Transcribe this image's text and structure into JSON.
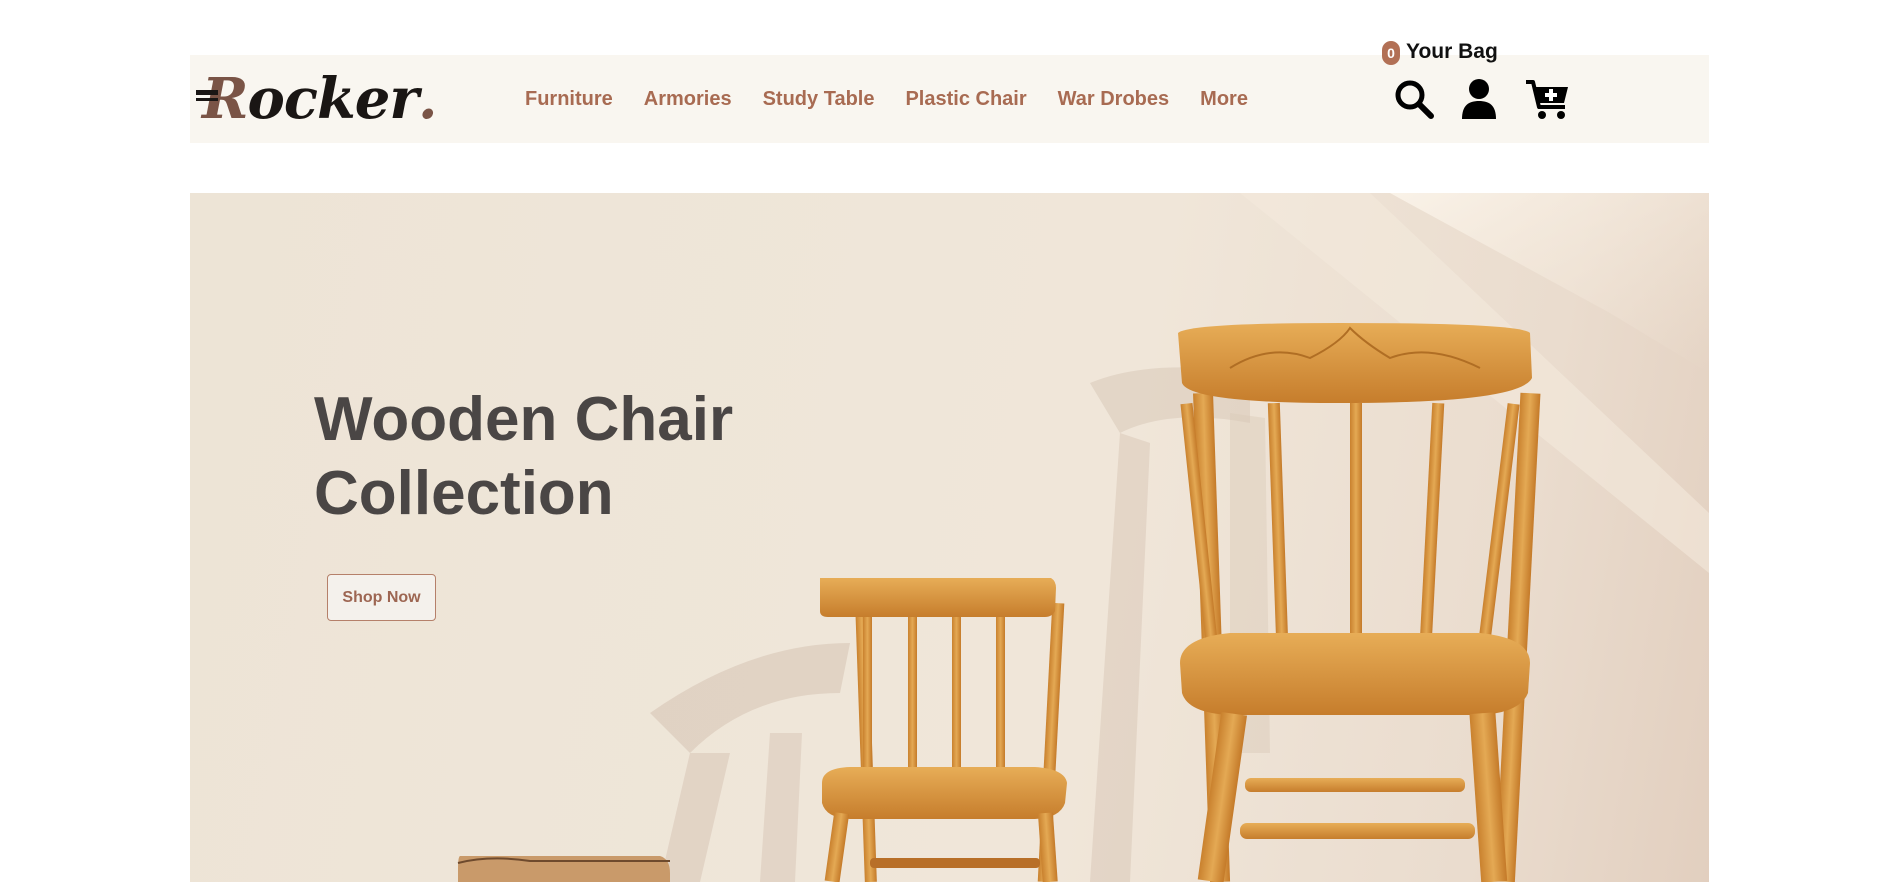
{
  "logo": {
    "text_lead": "R",
    "text_rest": "ocker",
    "text_dot": "."
  },
  "nav": {
    "items": [
      {
        "label": "Furniture"
      },
      {
        "label": "Armories"
      },
      {
        "label": "Study Table"
      },
      {
        "label": "Plastic Chair"
      },
      {
        "label": "War Drobes"
      },
      {
        "label": "More"
      }
    ]
  },
  "header_icons": {
    "search": "search-icon",
    "user": "user-icon",
    "cart": "cart-plus-icon",
    "cart_count": "0",
    "bag_label": "Your Bag"
  },
  "hero": {
    "title_line1": "Wooden Chair",
    "title_line2": "Collection",
    "button_label": "Shop Now"
  },
  "colors": {
    "accent": "#a86b52",
    "badge": "#b27055",
    "header_bg": "#f9f6f0",
    "title": "#4a4645",
    "wood": "#d99a45"
  }
}
